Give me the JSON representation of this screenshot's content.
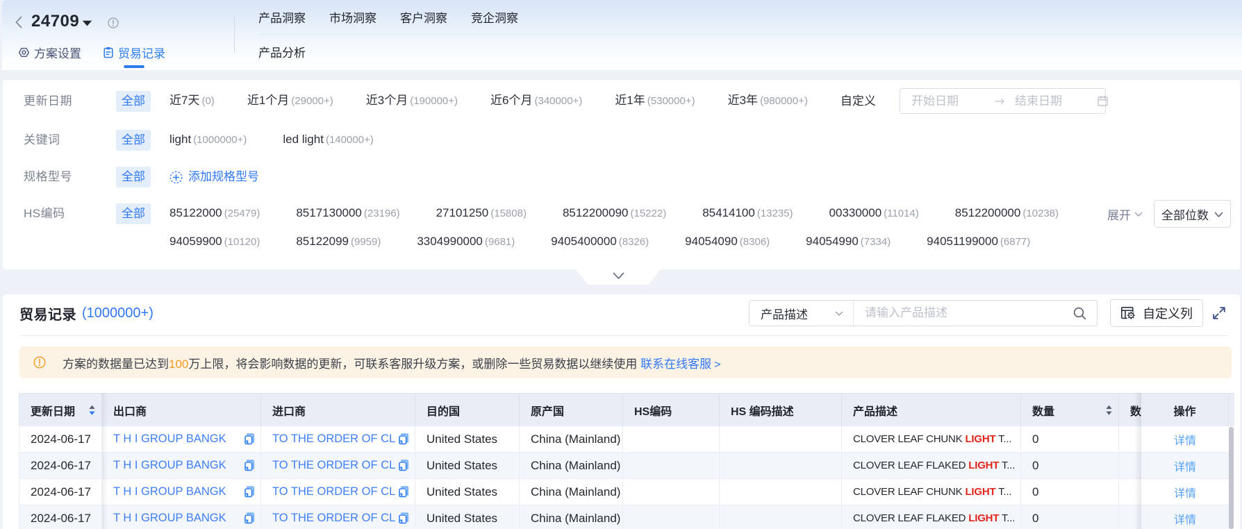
{
  "header": {
    "scheme_id": "24709",
    "sub_tabs": [
      {
        "label": "方案设置"
      },
      {
        "label": "贸易记录"
      }
    ],
    "nav_tabs": [
      "产品洞察",
      "市场洞察",
      "客户洞察",
      "竞企洞察"
    ],
    "nav_sub_tab": "产品分析"
  },
  "filters": {
    "all_label": "全部",
    "date": {
      "label": "更新日期",
      "options": [
        {
          "name": "近7天",
          "count": "(0)"
        },
        {
          "name": "近1个月",
          "count": "(29000+)"
        },
        {
          "name": "近3个月",
          "count": "(190000+)"
        },
        {
          "name": "近6个月",
          "count": "(340000+)"
        },
        {
          "name": "近1年",
          "count": "(530000+)"
        },
        {
          "name": "近3年",
          "count": "(980000+)"
        }
      ],
      "custom_label": "自定义",
      "start_placeholder": "开始日期",
      "end_placeholder": "结束日期"
    },
    "keyword": {
      "label": "关键词",
      "options": [
        {
          "name": "light",
          "count": "(1000000+)"
        },
        {
          "name": "led light",
          "count": "(140000+)"
        }
      ]
    },
    "spec": {
      "label": "规格型号",
      "add_label": "添加规格型号"
    },
    "hs": {
      "label": "HS编码",
      "options": [
        {
          "name": "85122000",
          "count": "(25479)"
        },
        {
          "name": "8517130000",
          "count": "(23196)"
        },
        {
          "name": "27101250",
          "count": "(15808)"
        },
        {
          "name": "8512200090",
          "count": "(15222)"
        },
        {
          "name": "85414100",
          "count": "(13235)"
        },
        {
          "name": "00330000",
          "count": "(11014)"
        },
        {
          "name": "8512200000",
          "count": "(10238)"
        },
        {
          "name": "94059900",
          "count": "(10120)"
        },
        {
          "name": "85122099",
          "count": "(9959)"
        },
        {
          "name": "3304990000",
          "count": "(9681)"
        },
        {
          "name": "9405400000",
          "count": "(8326)"
        },
        {
          "name": "94054090",
          "count": "(8306)"
        },
        {
          "name": "94054990",
          "count": "(7334)"
        },
        {
          "name": "94051199000",
          "count": "(6877)"
        }
      ],
      "expand_label": "展开",
      "digits_select": "全部位数"
    }
  },
  "records": {
    "title": "贸易记录",
    "count": "(1000000+)",
    "search_selector": "产品描述",
    "search_placeholder": "请输入产品描述",
    "custom_columns_label": "自定义列",
    "warning": {
      "text_before": "方案的数据量已达到",
      "highlight": "100",
      "text_after": "万上限，将会影响数据的更新，可联系客服升级方案，或删除一些贸易数据以继续使用",
      "link": "联系在线客服",
      "arrow": ">"
    },
    "table": {
      "columns": [
        "更新日期",
        "出口商",
        "进口商",
        "目的国",
        "原产国",
        "HS编码",
        "HS 编码描述",
        "产品描述",
        "数量",
        "数量单位",
        "操作"
      ],
      "action_label": "详情",
      "rows": [
        {
          "date": "2024-06-17",
          "exporter": "T H I GROUP BANGK",
          "importer": "TO THE ORDER OF CL",
          "dest": "United States",
          "origin": "China (Mainland)",
          "hs_code": "",
          "hs_desc": "",
          "desc_before": "CLOVER LEAF CHUNK ",
          "desc_highlight": "LIGHT",
          "desc_after": " T...",
          "qty": "0"
        },
        {
          "date": "2024-06-17",
          "exporter": "T H I GROUP BANGK",
          "importer": "TO THE ORDER OF CL",
          "dest": "United States",
          "origin": "China (Mainland)",
          "hs_code": "",
          "hs_desc": "",
          "desc_before": "CLOVER LEAF FLAKED ",
          "desc_highlight": "LIGHT",
          "desc_after": " T...",
          "qty": "0"
        },
        {
          "date": "2024-06-17",
          "exporter": "T H I GROUP BANGK",
          "importer": "TO THE ORDER OF CL",
          "dest": "United States",
          "origin": "China (Mainland)",
          "hs_code": "",
          "hs_desc": "",
          "desc_before": "CLOVER LEAF CHUNK ",
          "desc_highlight": "LIGHT",
          "desc_after": " T...",
          "qty": "0"
        },
        {
          "date": "2024-06-17",
          "exporter": "T H I GROUP BANGK",
          "importer": "TO THE ORDER OF CL",
          "dest": "United States",
          "origin": "China (Mainland)",
          "hs_code": "",
          "hs_desc": "",
          "desc_before": "CLOVER LEAF FLAKED ",
          "desc_highlight": "LIGHT",
          "desc_after": " T...",
          "qty": "0"
        }
      ]
    }
  },
  "colors": {
    "accent_blue": "#2f77f6",
    "link_light_blue": "#53a0f8",
    "highlight_red": "#e2241b",
    "warning_orange": "#f59a23",
    "warning_bg": "#fdf3e5",
    "chip_bg": "#e4eefb",
    "table_header_bg": "#e9edf6",
    "stripe_bg": "#f3f6fb",
    "page_bg": "#eef1f8"
  }
}
